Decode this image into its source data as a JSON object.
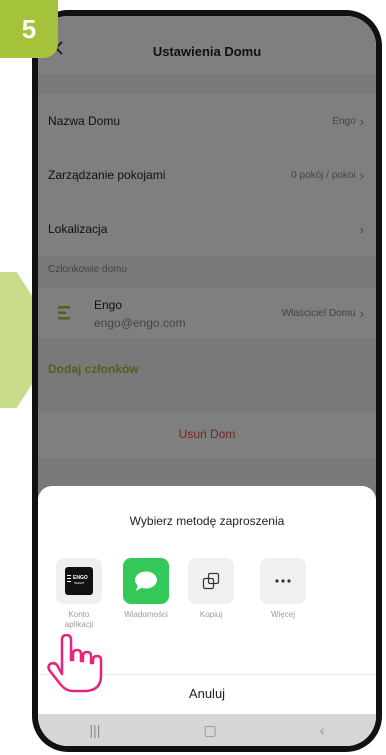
{
  "step_badge": "5",
  "header": {
    "title": "Ustawienia Domu",
    "back_icon": "chevron-left-icon"
  },
  "settings": {
    "home_name": {
      "label": "Nazwa Domu",
      "value": "Engo"
    },
    "rooms": {
      "label": "Zarządzanie pokojami",
      "value": "0 pokój / pokoi"
    },
    "location": {
      "label": "Lokalizacja"
    },
    "members_section": "Członkowie domu",
    "member": {
      "name": "Engo",
      "email": "engo@engo.com",
      "role": "Właściciel Domu"
    },
    "add_members": "Dodaj członków",
    "remove_home": "Usuń Dom"
  },
  "sheet": {
    "title": "Wybierz metodę zaproszenia",
    "options": [
      {
        "label": "Konto aplikacji",
        "icon": "engo-app-icon"
      },
      {
        "label": "Wiadomości",
        "icon": "messages-icon"
      },
      {
        "label": "Kopiuj",
        "icon": "copy-icon"
      },
      {
        "label": "Więcej",
        "icon": "more-icon"
      }
    ],
    "app_icon_text": "ENGO",
    "app_icon_subtext": "SMART",
    "cancel": "Anuluj"
  },
  "colors": {
    "accent_green": "#a4c23a",
    "danger": "#e5533d",
    "messages_green": "#34c759",
    "hand": "#e8247c"
  }
}
